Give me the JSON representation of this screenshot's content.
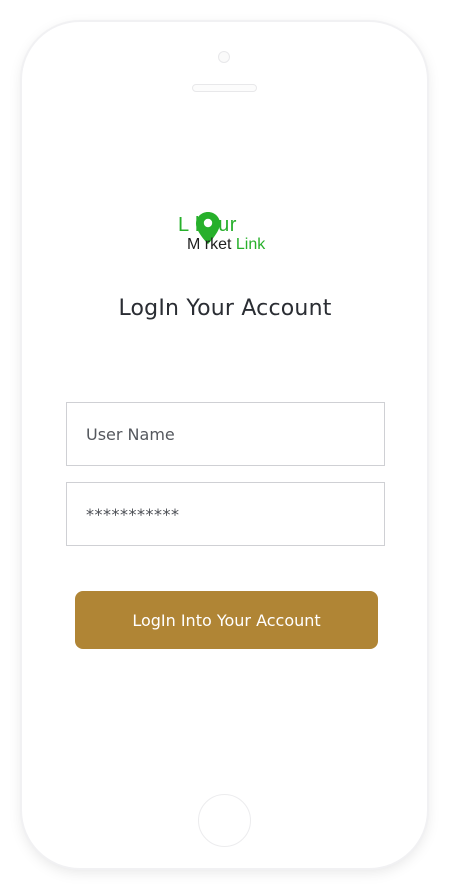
{
  "logo": {
    "line1": "L   bour",
    "line2_dark": "M  rket",
    "line2_green": "Link"
  },
  "page_title": "LogIn Your Account",
  "username_field": {
    "placeholder": "User Name",
    "value": ""
  },
  "password_field": {
    "value": "***********"
  },
  "login_button": {
    "label": "LogIn Into Your Account"
  },
  "colors": {
    "brand_green": "#27b02b",
    "button_gold": "#b08535"
  }
}
